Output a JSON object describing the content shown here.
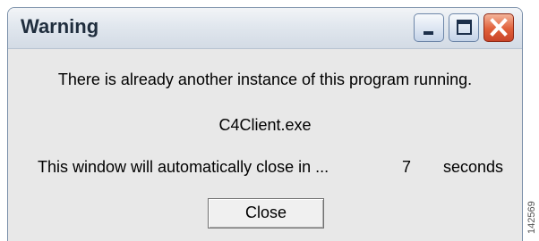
{
  "window": {
    "title": "Warning"
  },
  "message": {
    "line1": "There is already another instance of this program running.",
    "program": "C4Client.exe",
    "countdown_prefix": "This window will automatically close in ...",
    "countdown_value": "7",
    "countdown_unit": "seconds"
  },
  "buttons": {
    "close_label": "Close"
  },
  "watermark": {
    "id": "142569"
  },
  "colors": {
    "dialog_background": "#e8e8e8",
    "close_caption": "#e0603a",
    "title_text": "#1f2d3d"
  },
  "icons": {
    "minimize": "minimize-icon",
    "maximize": "maximize-icon",
    "close": "close-icon"
  }
}
